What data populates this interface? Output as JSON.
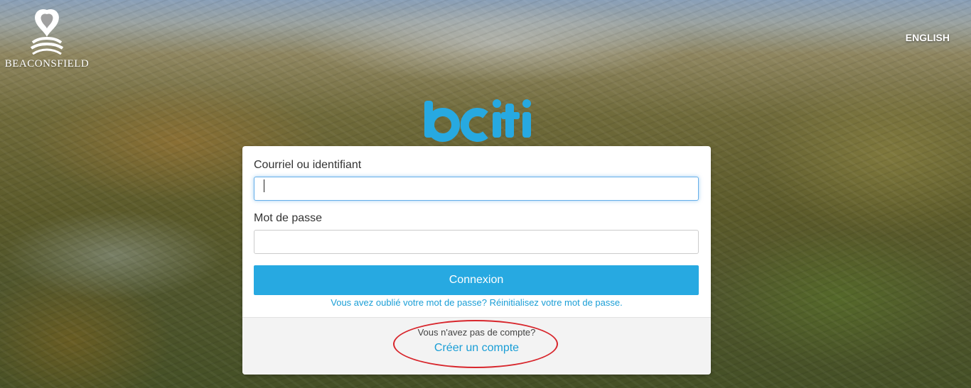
{
  "brand": {
    "name": "BEACONSFIELD",
    "logo_icon": "beaconsfield-logo-icon"
  },
  "language_toggle": "ENGLISH",
  "app_logo": {
    "text": "bciti",
    "color": "#27a9e1"
  },
  "login": {
    "username_label": "Courriel ou identifiant",
    "username_value": "",
    "password_label": "Mot de passe",
    "password_value": "",
    "submit_label": "Connexion",
    "forgot_text": "Vous avez oublié votre mot de passe? Réinitialisez votre mot de passe.",
    "no_account_text": "Vous n'avez pas de compte?",
    "create_account_label": "Créer un compte"
  },
  "annotation": {
    "color": "#d8262c",
    "shape": "ellipse",
    "target": "create-account-link"
  },
  "colors": {
    "accent": "#27a9e1",
    "link": "#1a9ed6"
  }
}
